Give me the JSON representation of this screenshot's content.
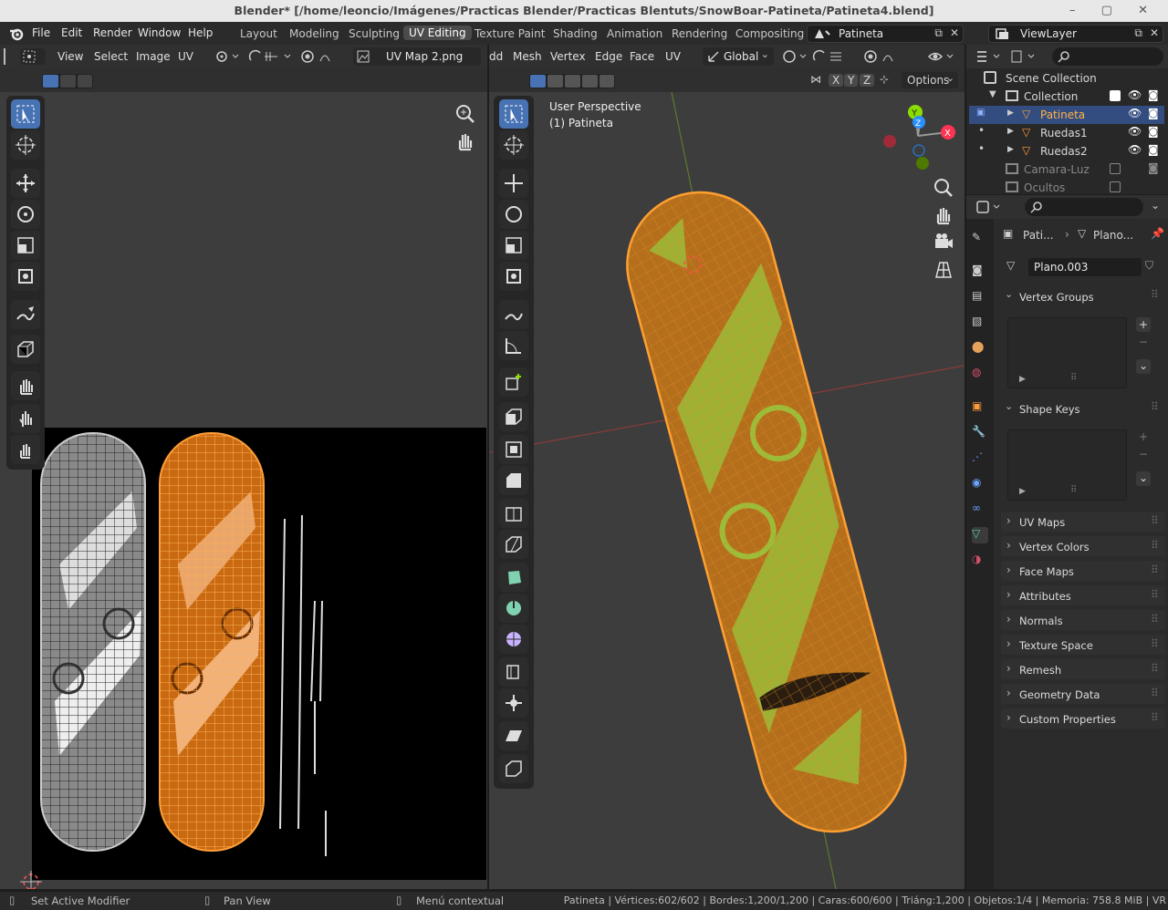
{
  "window": {
    "title": "Blender* [/home/leoncio/Imágenes/Practicas Blender/Practicas Blentuts/SnowBoar-Patineta/Patineta4.blend]",
    "controls": "– ▢ ✕"
  },
  "menu": [
    "File",
    "Edit",
    "Render",
    "Window",
    "Help"
  ],
  "workspaces": [
    "Layout",
    "Modeling",
    "Sculpting",
    "UV Editing",
    "Texture Paint",
    "Shading",
    "Animation",
    "Rendering",
    "Compositing"
  ],
  "active_workspace": "UV Editing",
  "scene": {
    "name": "Patineta",
    "view_layer": "ViewLayer"
  },
  "uv_editor": {
    "menus": [
      "View",
      "Select",
      "Image",
      "UV"
    ],
    "image_name": "UV Map 2.png"
  },
  "viewport": {
    "menus": [
      "dd",
      "Mesh",
      "Vertex",
      "Edge",
      "Face",
      "UV"
    ],
    "orientation": "Global",
    "axes": [
      "X",
      "Y",
      "Z"
    ],
    "options": "Options",
    "view_label": "User Perspective",
    "object_label": "(1) Patineta"
  },
  "outliner": {
    "scene_collection": "Scene Collection",
    "collection": "Collection",
    "items": [
      {
        "name": "Patineta",
        "selected": true
      },
      {
        "name": "Ruedas1",
        "selected": false
      },
      {
        "name": "Ruedas2",
        "selected": false
      }
    ],
    "other": [
      {
        "name": "Camara-Luz"
      },
      {
        "name": "Ocultos"
      }
    ]
  },
  "properties": {
    "breadcrumb_object": "Pati...",
    "breadcrumb_mesh": "Plano...",
    "mesh_name": "Plano.003",
    "panels_open": [
      "Vertex Groups",
      "Shape Keys"
    ],
    "panels_closed": [
      "UV Maps",
      "Vertex Colors",
      "Face Maps",
      "Attributes",
      "Normals",
      "Texture Space",
      "Remesh",
      "Geometry Data",
      "Custom Properties"
    ]
  },
  "status": {
    "left": "Set Active Modifier",
    "middle": "Pan View",
    "right_hint": "Menú contextual",
    "stats": "Patineta | Vértices:602/602 | Bordes:1,200/1,200 | Caras:600/600 | Triáng:1,200 | Objetos:1/4 | Memoria: 758.8 MiB | VR"
  },
  "colors": {
    "accent": "#4772b3",
    "selection": "#ffa033",
    "header": "#303030",
    "viewport_bg": "#3d3d3d",
    "uv_bg": "#000000"
  }
}
